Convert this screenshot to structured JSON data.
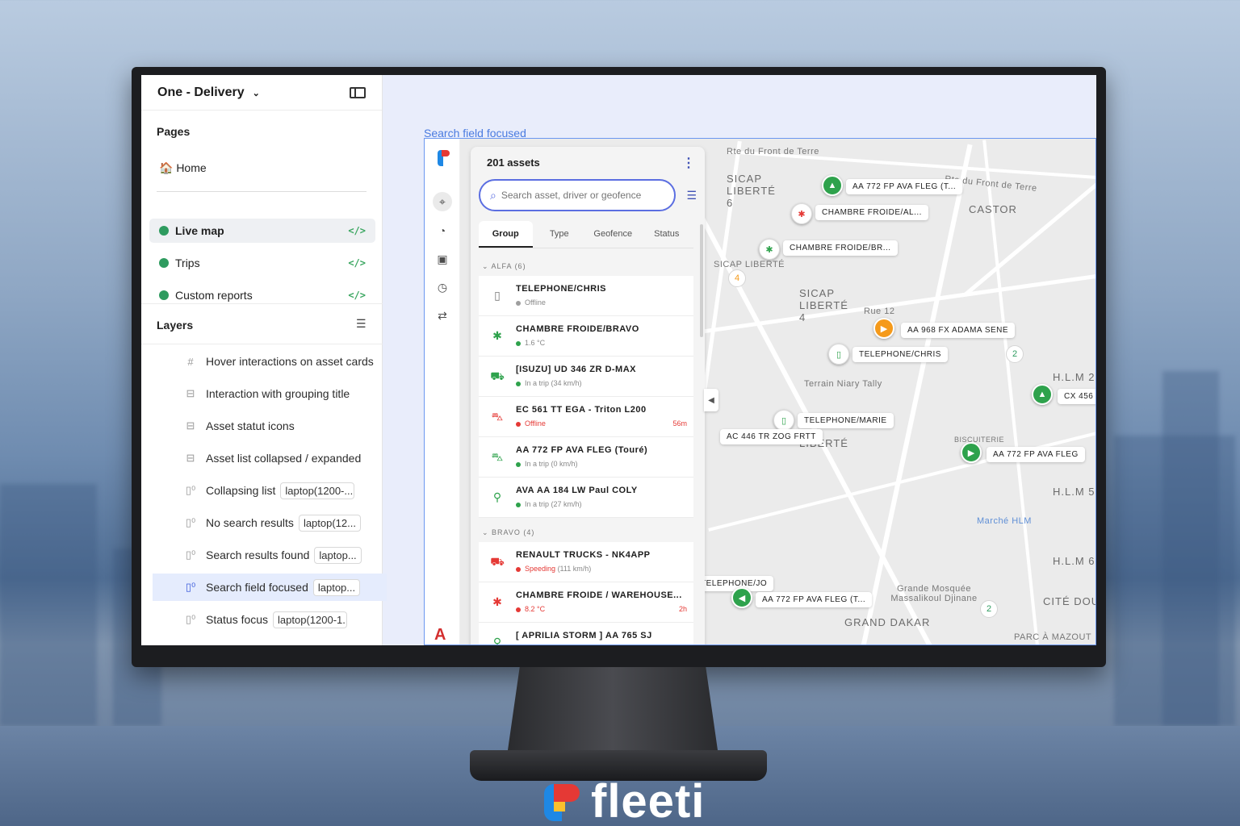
{
  "editor": {
    "title": "One - Delivery",
    "pages_heading": "Pages",
    "pages": [
      {
        "label": "🏠 Home"
      },
      {
        "label": "Live map",
        "active": true
      },
      {
        "label": "Trips"
      },
      {
        "label": "Custom reports"
      }
    ],
    "layers_heading": "Layers",
    "layers": [
      {
        "label": "Hover interactions on asset cards",
        "chip": ""
      },
      {
        "label": "Interaction with grouping title",
        "chip": ""
      },
      {
        "label": "Asset statut icons",
        "chip": ""
      },
      {
        "label": "Asset list collapsed / expanded",
        "chip": ""
      },
      {
        "label": "Collapsing list",
        "chip": "laptop(1200-..."
      },
      {
        "label": "No search results",
        "chip": "laptop(12..."
      },
      {
        "label": "Search results found",
        "chip": "laptop..."
      },
      {
        "label": "Search field focused",
        "chip": "laptop...",
        "selected": true
      },
      {
        "label": "Status focus",
        "chip": "laptop(1200-1..."
      }
    ]
  },
  "canvas": {
    "frame_label": "Search field focused"
  },
  "panel": {
    "count": "201 assets",
    "search_placeholder": "Search asset, driver or geofence",
    "tabs": [
      "Group",
      "Type",
      "Geofence",
      "Status"
    ],
    "groups": [
      {
        "title": "ALFA (6)",
        "assets": [
          {
            "name": "TELEPHONE/CHRIS",
            "status": "Offline",
            "status_color": "#9e9e9e",
            "icon": "phone-icon",
            "time": ""
          },
          {
            "name": "CHAMBRE FROIDE/BRAVO",
            "status": "1.6 °C",
            "status_color": "#2ea24c",
            "icon": "snowflake-icon",
            "time": ""
          },
          {
            "name": "[ISUZU] UD 346 ZR D-MAX",
            "status": "In a trip (34 km/h)",
            "status_color": "#2ea24c",
            "icon": "truck-icon",
            "time": ""
          },
          {
            "name": "EC 561 TT EGA - Triton L200",
            "status": "Offline",
            "status_color": "#e53935",
            "icon": "car-icon",
            "time": "56m"
          },
          {
            "name": "AA 772 FP AVA FLEG (Touré)",
            "status": "In a trip (0 km/h)",
            "status_color": "#2ea24c",
            "icon": "car-icon",
            "time": ""
          },
          {
            "name": "AVA AA 184 LW Paul COLY",
            "status": "In a trip (27 km/h)",
            "status_color": "#2ea24c",
            "icon": "motorbike-icon",
            "time": ""
          }
        ]
      },
      {
        "title": "BRAVO (4)",
        "assets": [
          {
            "name": "RENAULT TRUCKS - NK4APP",
            "status": "Speeding",
            "status_extra": "(111 km/h)",
            "status_color": "#e53935",
            "icon": "truck-icon",
            "time": ""
          },
          {
            "name": "CHAMBRE FROIDE / WAREHOUSE...",
            "status": "8.2 °C",
            "status_color": "#e53935",
            "icon": "snowflake-icon",
            "time": "2h"
          },
          {
            "name": "[ APRILIA STORM ] AA 765 SJ",
            "status": "",
            "status_color": "#2ea24c",
            "icon": "motorbike-icon",
            "time": ""
          }
        ]
      }
    ]
  },
  "map": {
    "labels": {
      "sicap_liberte6": "SICAP LIBERTÉ 6",
      "castor": "CASTOR",
      "sicap_liberte": "SICAP LIBERTÉ",
      "sicap_liberte4": "SICAP LIBERTÉ 4",
      "terrain": "Terrain Niary Tally",
      "grand_dakar": "GRAND DAKAR",
      "marche": "Marché HLM",
      "mosquee": "Grande Mosquée Massalikoul Djinane",
      "hlm2": "H.L.M 2",
      "hlm5": "H.L.M 5",
      "hlm6": "H.L.M 6",
      "cite_douanes": "CITÉ DOUA",
      "parc": "PARC À MAZOUT",
      "rte_front": "Rte du Front de Terre",
      "rue12": "Rue 12",
      "liberte": "LIBERTÉ",
      "biscuiterie": "BISCUITERIE"
    },
    "tags": [
      "AA 772 FP AVA FLEG (T...",
      "CHAMBRE FROIDE/AL...",
      "CHAMBRE FROIDE/BR...",
      "AA 968 FX ADAMA SENE",
      "TELEPHONE/CHRIS",
      "CX 456",
      "TELEPHONE/MARIE",
      "AC 446 TR ZOG FRTT",
      "AA 772 FP AVA FLEG",
      "TELEPHONE/JO",
      "AA 772 FP AVA FLEG (T..."
    ],
    "clusters": [
      "4",
      "2",
      "2"
    ]
  },
  "brand": {
    "name": "fleeti"
  },
  "colors": {
    "accent": "#5b6ee1",
    "online": "#2ea24c",
    "alert": "#e53935",
    "warning": "#f59a1b"
  }
}
